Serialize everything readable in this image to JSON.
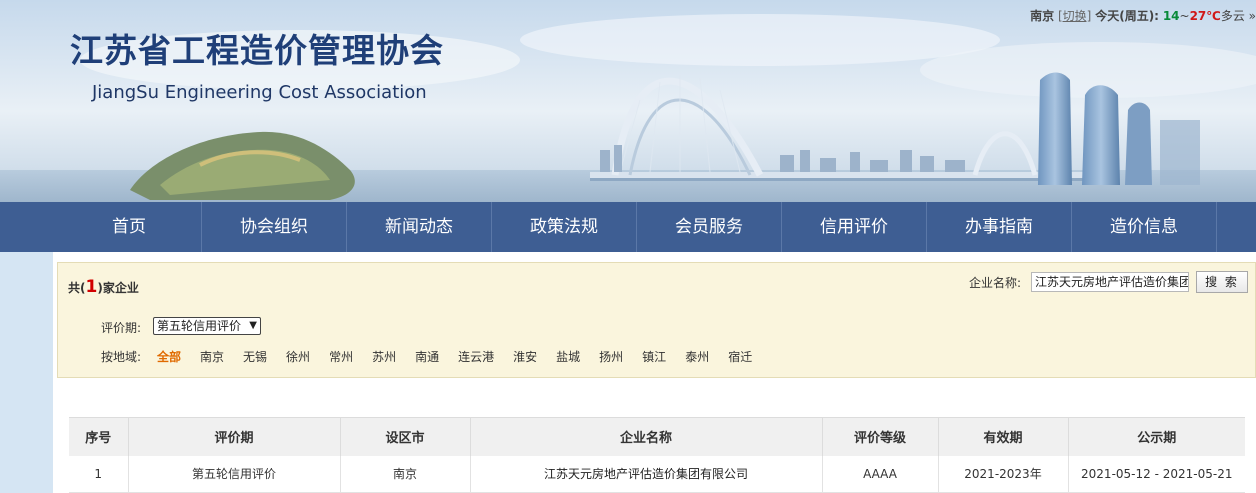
{
  "header": {
    "title": "江苏省工程造价管理协会",
    "subtitle": "JiangSu Engineering Cost Association",
    "weather": {
      "city": "南京",
      "switch_label": "[切换]",
      "today": "今天(周五):",
      "temp_low": "14",
      "separator": "~",
      "temp_high": "27℃",
      "condition": "多云",
      "more": "»"
    }
  },
  "nav": {
    "items": [
      "首页",
      "协会组织",
      "新闻动态",
      "政策法规",
      "会员服务",
      "信用评价",
      "办事指南",
      "造价信息"
    ]
  },
  "filter": {
    "count_prefix": "共(",
    "count": "1",
    "count_suffix": ")家企业",
    "search_label": "企业名称:",
    "search_value": "江苏天元房地产评估造价集团",
    "search_button": "搜 索",
    "period_label": "评价期:",
    "period_selected": "第五轮信用评价",
    "region_label": "按地域:",
    "regions": [
      "全部",
      "南京",
      "无锡",
      "徐州",
      "常州",
      "苏州",
      "南通",
      "连云港",
      "淮安",
      "盐城",
      "扬州",
      "镇江",
      "泰州",
      "宿迁"
    ],
    "active_region": "全部"
  },
  "table": {
    "columns": [
      "序号",
      "评价期",
      "设区市",
      "企业名称",
      "评价等级",
      "有效期",
      "公示期"
    ],
    "rows": [
      [
        "1",
        "第五轮信用评价",
        "南京",
        "江苏天元房地产评估造价集团有限公司",
        "AAAA",
        "2021-2023年",
        "2021-05-12 - 2021-05-21"
      ]
    ]
  },
  "colors": {
    "nav_bg": "#3e5e93",
    "title": "#1f3f78",
    "filter_bg": "#faf5dd",
    "count_red": "#d10000",
    "active_region": "#e06a00"
  }
}
